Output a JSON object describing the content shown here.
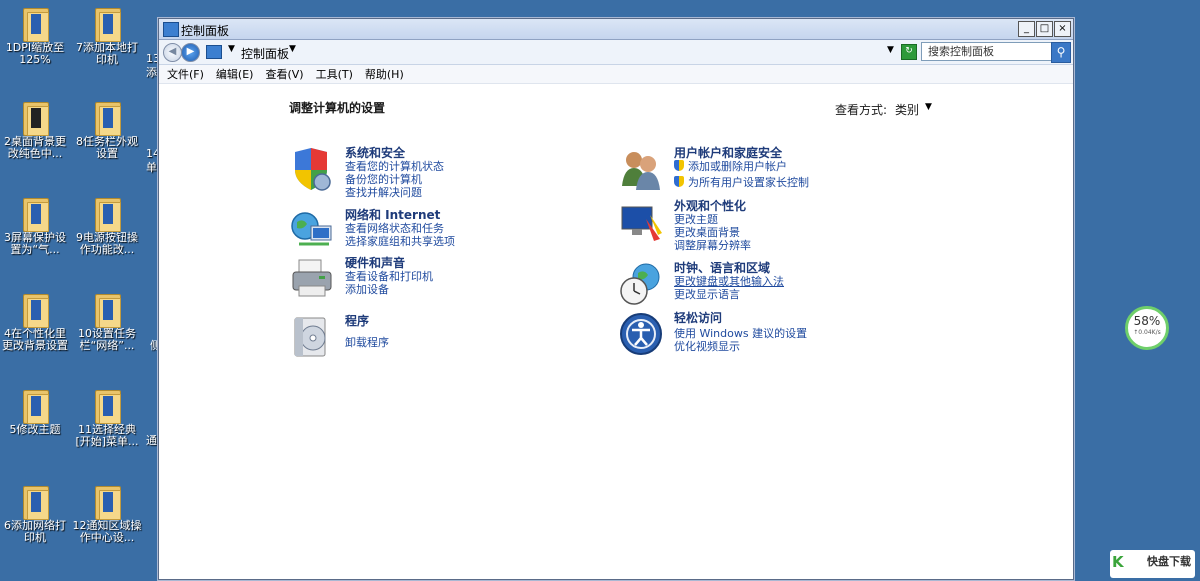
{
  "desktop": {
    "icons": [
      {
        "label": "1DPI缩放至125%"
      },
      {
        "label": "7添加本地打印机"
      },
      {
        "label": "2桌面背景更改纯色中..."
      },
      {
        "label": "8任务栏外观设置"
      },
      {
        "label": "3屏幕保护设置为“气..."
      },
      {
        "label": "9电源按钮操作功能改..."
      },
      {
        "label": "4在个性化里更改背景设置"
      },
      {
        "label": "10设置任务栏“网络”..."
      },
      {
        "label": "5修改主题"
      },
      {
        "label": "11选择经典[开始]菜单..."
      },
      {
        "label": "6添加网络打印机"
      },
      {
        "label": "12通知区域操作中心设..."
      }
    ],
    "partial_labels": [
      "13",
      "添",
      "14",
      "单",
      "侧",
      "通"
    ]
  },
  "window": {
    "title": "控制面板",
    "buttons": {
      "minimize": "_",
      "maximize": "□",
      "close": "×"
    },
    "breadcrumb": "控制面板",
    "search_placeholder": "搜索控制面板",
    "menu": [
      "文件(F)",
      "编辑(E)",
      "查看(V)",
      "工具(T)",
      "帮助(H)"
    ]
  },
  "content": {
    "heading": "调整计算机的设置",
    "view_by_label": "查看方式:",
    "view_by_value": "类别",
    "categories": [
      {
        "title": "系统和安全",
        "links": [
          "查看您的计算机状态",
          "备份您的计算机",
          "查找并解决问题"
        ]
      },
      {
        "title": "网络和 Internet",
        "links": [
          "查看网络状态和任务",
          "选择家庭组和共享选项"
        ]
      },
      {
        "title": "硬件和声音",
        "links": [
          "查看设备和打印机",
          "添加设备"
        ]
      },
      {
        "title": "程序",
        "links": [
          "卸载程序"
        ]
      },
      {
        "title": "用户帐户和家庭安全",
        "links": [
          "添加或删除用户帐户",
          "为所有用户设置家长控制"
        ]
      },
      {
        "title": "外观和个性化",
        "links": [
          "更改主题",
          "更改桌面背景",
          "调整屏幕分辨率"
        ]
      },
      {
        "title": "时钟、语言和区域",
        "links": [
          "更改键盘或其他输入法",
          "更改显示语言"
        ]
      },
      {
        "title": "轻松访问",
        "links": [
          "使用 Windows 建议的设置",
          "优化视频显示"
        ]
      }
    ]
  },
  "widget": {
    "percent": "58%",
    "speed": "↑0.04K/s"
  },
  "watermark": {
    "logo": "K",
    "text": "快盘下载"
  }
}
